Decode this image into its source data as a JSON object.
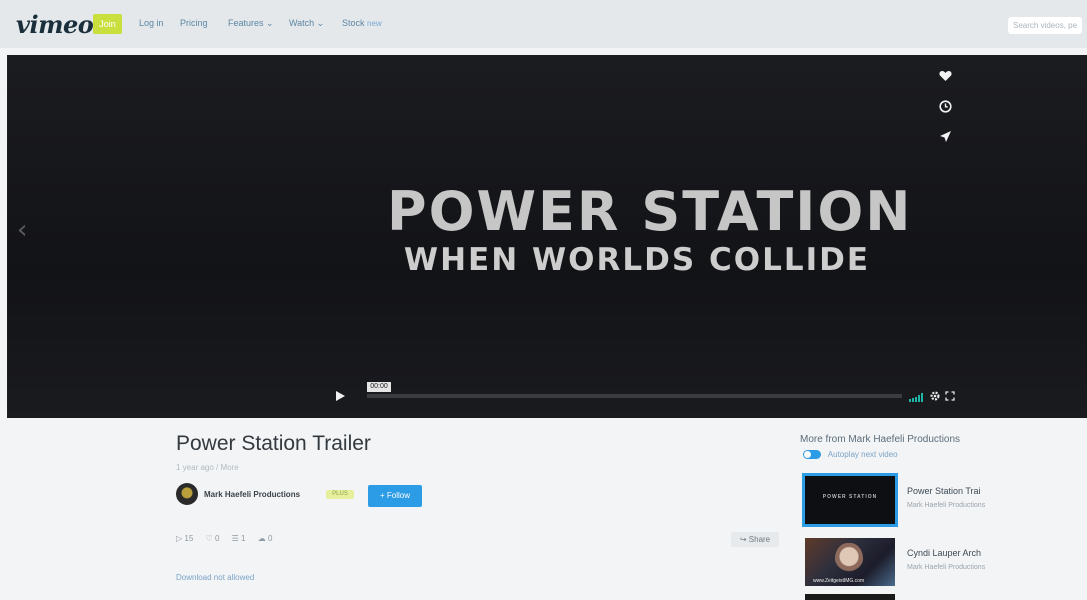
{
  "header": {
    "logo": "vimeo",
    "join_label": "Join",
    "nav": [
      {
        "label": "Log in"
      },
      {
        "label": "Pricing"
      },
      {
        "label": "Features ⌄"
      },
      {
        "label": "Watch ⌄"
      },
      {
        "label": "Stock",
        "badge": "new"
      }
    ],
    "search_placeholder": "Search videos, pe"
  },
  "player": {
    "title_line1": "POWER STATION",
    "title_line2": "WHEN WORLDS COLLIDE",
    "time": "00:00",
    "side_icons": [
      "heart-icon",
      "clock-icon",
      "send-icon"
    ]
  },
  "video": {
    "title": "Power Station Trailer",
    "meta": "1 year ago / More",
    "owner": "Mark Haefeli Productions",
    "owner_badge": "PLUS",
    "follow_label": "+ Follow",
    "stats": [
      {
        "icon": "▷",
        "value": "15"
      },
      {
        "icon": "♡",
        "value": "0"
      },
      {
        "icon": "☰",
        "value": "1"
      },
      {
        "icon": "☁",
        "value": "0"
      }
    ],
    "share_label": "↪ Share",
    "download_label": "Download not allowed"
  },
  "sidebar": {
    "title": "More from Mark Haefeli Productions",
    "autoplay_label": "Autoplay next video",
    "items": [
      {
        "title": "Power Station Trai",
        "owner": "Mark Haefeli Productions",
        "thumb_text": "POWER STATION"
      },
      {
        "title": "Cyndi Lauper Arch",
        "owner": "Mark Haefeli Productions",
        "thumb_text": "www.ZeitgeistIMG.com"
      }
    ]
  }
}
